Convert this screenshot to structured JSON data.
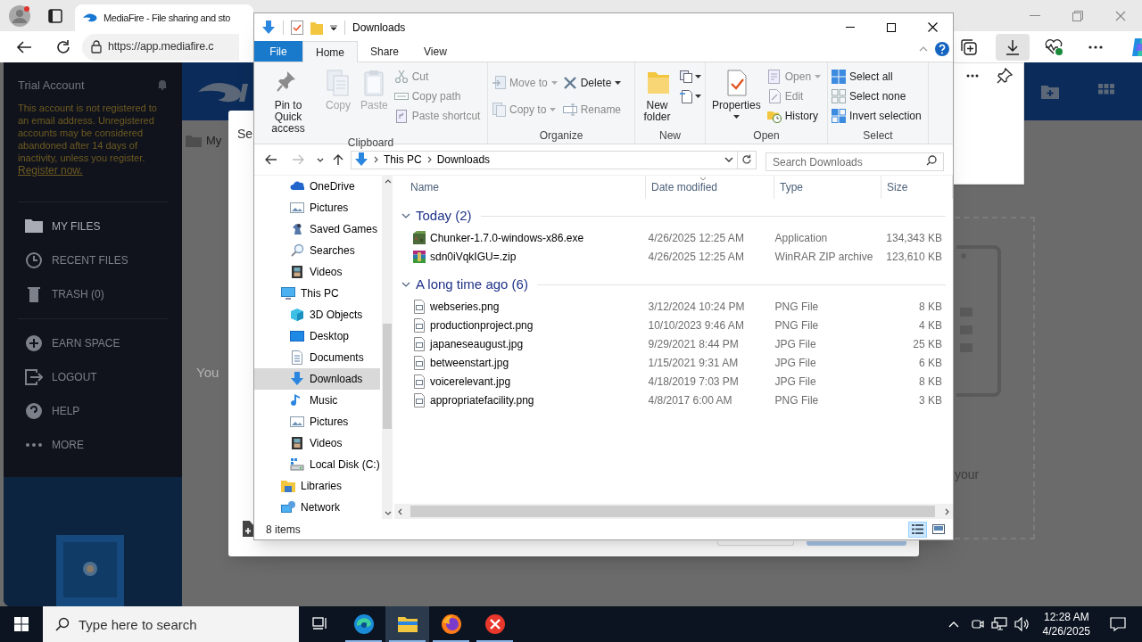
{
  "browser": {
    "tab_title": "MediaFire - File sharing and sto",
    "url": "https://app.mediafire.c"
  },
  "mediafire": {
    "account_title": "Trial Account",
    "notice": "This account is not registered to an email address. Unregistered accounts may be considered abandoned after 14 days of inactivity, unless you register.",
    "register_link": "Register now.",
    "nav": [
      {
        "label": "MY FILES",
        "selected": true
      },
      {
        "label": "RECENT FILES",
        "selected": false
      },
      {
        "label": "TRASH (0)",
        "selected": false
      },
      {
        "label": "EARN SPACE",
        "selected": false
      },
      {
        "label": "LOGOUT",
        "selected": false
      },
      {
        "label": "HELP",
        "selected": false
      },
      {
        "label": "MORE",
        "selected": false
      }
    ],
    "breadcrumb": "My",
    "dialog_title": "Se",
    "empty_hint": "You",
    "upload_hint": "your"
  },
  "explorer": {
    "title": "Downloads",
    "ribbon_tabs": [
      {
        "label": "File",
        "selected": false
      },
      {
        "label": "Home",
        "selected": true
      },
      {
        "label": "Share",
        "selected": false
      },
      {
        "label": "View",
        "selected": false
      }
    ],
    "ribbon_groups": [
      {
        "label": "Clipboard",
        "columns": [
          [
            {
              "kind": "large",
              "label": "Pin to Quick access",
              "disabled": false,
              "dropdown": false
            }
          ],
          [
            {
              "kind": "large",
              "label": "Copy",
              "disabled": true,
              "dropdown": false
            }
          ],
          [
            {
              "kind": "large",
              "label": "Paste",
              "disabled": true,
              "dropdown": false
            }
          ],
          [
            {
              "kind": "small",
              "label": "Cut",
              "disabled": true,
              "dropdown": false
            },
            {
              "kind": "small",
              "label": "Copy path",
              "disabled": true,
              "dropdown": false
            },
            {
              "kind": "small",
              "label": "Paste shortcut",
              "disabled": true,
              "dropdown": false
            }
          ]
        ]
      },
      {
        "label": "Organize",
        "columns": [
          [
            {
              "kind": "small",
              "label": "Move to",
              "disabled": true,
              "dropdown": true
            },
            {
              "kind": "small",
              "label": "Copy to",
              "disabled": true,
              "dropdown": true
            }
          ],
          [
            {
              "kind": "small",
              "label": "Delete",
              "disabled": false,
              "dropdown": true
            },
            {
              "kind": "small",
              "label": "Rename",
              "disabled": true,
              "dropdown": false
            }
          ]
        ]
      },
      {
        "label": "New",
        "columns": [
          [
            {
              "kind": "large",
              "label": "New folder",
              "disabled": false,
              "dropdown": false
            }
          ],
          [
            {
              "kind": "icon",
              "disabled": false,
              "dropdown": true
            },
            {
              "kind": "icon",
              "disabled": false,
              "dropdown": true
            }
          ]
        ]
      },
      {
        "label": "Open",
        "columns": [
          [
            {
              "kind": "large",
              "label": "Properties",
              "disabled": false,
              "dropdown": true
            }
          ],
          [
            {
              "kind": "small",
              "label": "Open",
              "disabled": true,
              "dropdown": true
            },
            {
              "kind": "small",
              "label": "Edit",
              "disabled": true,
              "dropdown": false
            },
            {
              "kind": "small",
              "label": "History",
              "disabled": false,
              "dropdown": false
            }
          ]
        ]
      },
      {
        "label": "Select",
        "columns": [
          [
            {
              "kind": "small",
              "label": "Select all",
              "disabled": false,
              "dropdown": false
            },
            {
              "kind": "small",
              "label": "Select none",
              "disabled": false,
              "dropdown": false
            },
            {
              "kind": "small",
              "label": "Invert selection",
              "disabled": false,
              "dropdown": false
            }
          ]
        ]
      }
    ],
    "address": [
      "This PC",
      "Downloads"
    ],
    "search_placeholder": "Search Downloads",
    "nav_tree": {
      "items_above": [
        {
          "label": "OneDrive",
          "selected": false
        },
        {
          "label": "Pictures",
          "selected": false
        },
        {
          "label": "Saved Games",
          "selected": false
        },
        {
          "label": "Searches",
          "selected": false
        },
        {
          "label": "Videos",
          "selected": false
        }
      ],
      "items": [
        {
          "label": "This PC",
          "selected": false,
          "children": [
            {
              "label": "3D Objects",
              "selected": false
            },
            {
              "label": "Desktop",
              "selected": false
            },
            {
              "label": "Documents",
              "selected": false
            },
            {
              "label": "Downloads",
              "selected": true
            },
            {
              "label": "Music",
              "selected": false
            },
            {
              "label": "Pictures",
              "selected": false
            },
            {
              "label": "Videos",
              "selected": false
            },
            {
              "label": "Local Disk (C:)",
              "selected": false
            }
          ]
        },
        {
          "label": "Libraries",
          "selected": false
        },
        {
          "label": "Network",
          "selected": false
        }
      ]
    },
    "columns": [
      "Name",
      "Date modified",
      "Type",
      "Size"
    ],
    "groups": [
      {
        "label": "Today (2)",
        "expanded": true,
        "files": [
          {
            "kind": "application",
            "name": "Chunker-1.7.0-windows-x86.exe",
            "date": "4/26/2025 12:25 AM",
            "type": "Application",
            "size": "134,343 KB"
          },
          {
            "kind": "archive",
            "name": "sdn0iVqkIGU=.zip",
            "date": "4/26/2025 12:25 AM",
            "type": "WinRAR ZIP archive",
            "size": "123,610 KB"
          }
        ]
      },
      {
        "label": "A long time ago (6)",
        "expanded": true,
        "files": [
          {
            "kind": "image",
            "name": "webseries.png",
            "date": "3/12/2024 10:24 PM",
            "type": "PNG File",
            "size": "8 KB"
          },
          {
            "kind": "image",
            "name": "productionproject.png",
            "date": "10/10/2023 9:46 AM",
            "type": "PNG File",
            "size": "4 KB"
          },
          {
            "kind": "image",
            "name": "japaneseaugust.jpg",
            "date": "9/29/2021 8:44 PM",
            "type": "JPG File",
            "size": "25 KB"
          },
          {
            "kind": "image",
            "name": "betweenstart.jpg",
            "date": "1/15/2021 9:31 AM",
            "type": "JPG File",
            "size": "6 KB"
          },
          {
            "kind": "image",
            "name": "voicerelevant.jpg",
            "date": "4/18/2019 7:03 PM",
            "type": "JPG File",
            "size": "8 KB"
          },
          {
            "kind": "image",
            "name": "appropriatefacility.png",
            "date": "4/8/2017 6:00 AM",
            "type": "PNG File",
            "size": "3 KB"
          }
        ]
      }
    ],
    "status": "8 items"
  },
  "taskbar": {
    "search_placeholder": "Type here to search",
    "apps": [
      {
        "kind": "edge",
        "selected": false
      },
      {
        "kind": "explorer",
        "selected": true
      },
      {
        "kind": "firefox",
        "selected": false
      },
      {
        "kind": "error",
        "selected": false
      }
    ],
    "time": "12:28 AM",
    "date": "4/26/2025"
  }
}
